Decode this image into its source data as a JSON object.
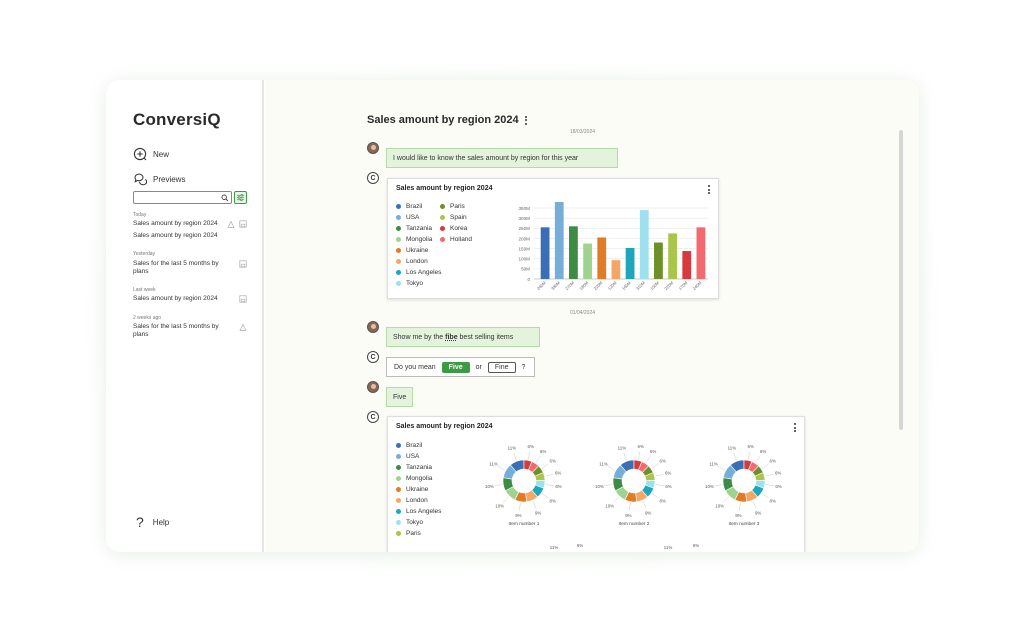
{
  "app": {
    "name": "ConversiQ"
  },
  "sidebar": {
    "new_label": "New",
    "previews_label": "Previews",
    "search_placeholder": "",
    "groups": [
      {
        "label": "Today",
        "items": [
          "Sales amount by region 2024",
          "Sales amount by region 2024"
        ]
      },
      {
        "label": "Yesterday",
        "items": [
          "Sales for the last 5 months by plans"
        ]
      },
      {
        "label": "Last week",
        "items": [
          "Sales amount by region 2024"
        ]
      },
      {
        "label": "2 weeks ago",
        "items": [
          "Sales for the last 5 months by plans"
        ]
      }
    ],
    "help_label": "Help"
  },
  "conversation": {
    "title": "Sales amount by region 2024",
    "date1": "18/03/2024",
    "date2": "01/04/2024",
    "msg1": "I would like to know the sales amount by region for this year",
    "msg2_pre": "Show me by the ",
    "msg2_word": "fibe",
    "msg2_post": " best selling items",
    "q_text": "Do you mean",
    "q_opt_a": "Five",
    "q_or": "or",
    "q_opt_b": "Fine",
    "q_end": "?",
    "msg3": "Five",
    "bot_mark": "C"
  },
  "chart_data": [
    {
      "type": "bar",
      "title": "Sales amount by region 2024",
      "categories": [
        "Brazil",
        "USA",
        "Tanzania",
        "Mongolia",
        "Ukraine",
        "London",
        "Los Angeles",
        "Tokyo",
        "Paris",
        "Spain",
        "Korea",
        "Holland"
      ],
      "values": [
        255,
        380,
        260,
        175,
        205,
        93,
        153,
        340,
        180,
        225,
        138,
        255
      ],
      "value_labels": [
        "240M",
        "380M",
        "270M",
        "180M",
        "220M",
        "120M",
        "160M",
        "310M",
        "150M",
        "220M",
        "170M",
        "240M"
      ],
      "colors": [
        "#3a6fb5",
        "#74aed9",
        "#3d8b45",
        "#9fd48f",
        "#e07c26",
        "#f4a765",
        "#1ea6bd",
        "#9ee0ee",
        "#6f8f2a",
        "#a9c54a",
        "#d63a3e",
        "#f26a6f"
      ],
      "y_ticks": [
        "0",
        "50M",
        "100M",
        "150M",
        "200M",
        "250M",
        "300M",
        "350M"
      ],
      "ylim": [
        0,
        380
      ],
      "grid": true,
      "legend": "left"
    },
    {
      "type": "pie",
      "title": "Sales amount by region 2024",
      "legend": [
        "Brazil",
        "USA",
        "Tanzania",
        "Mongolia",
        "Ukraine",
        "London",
        "Los Angeles",
        "Tokyo",
        "Paris"
      ],
      "donuts": [
        {
          "label": "Item number 1",
          "slices": [
            11,
            6,
            6,
            6,
            6,
            6,
            8,
            9,
            9,
            10,
            10,
            11
          ]
        },
        {
          "label": "Item number 2",
          "slices": [
            11,
            6,
            6,
            6,
            6,
            6,
            8,
            9,
            9,
            10,
            10,
            11
          ]
        },
        {
          "label": "Item number 3",
          "slices": [
            11,
            6,
            6,
            6,
            6,
            6,
            8,
            9,
            9,
            10,
            10,
            11
          ]
        }
      ],
      "slice_labels": [
        "11%",
        "6%",
        "6%",
        "6%",
        "6%",
        "6%",
        "8%",
        "9%",
        "9%",
        "10%",
        "10%",
        "11%"
      ],
      "colors": [
        "#3a6fb5",
        "#d63a3e",
        "#f26a6f",
        "#6f8f2a",
        "#a9c54a",
        "#9ee0ee",
        "#1ea6bd",
        "#f4a765",
        "#e07c26",
        "#9fd48f",
        "#3d8b45",
        "#74aed9"
      ],
      "partial_labels": [
        "11%",
        "6%",
        "11%",
        "6%"
      ]
    }
  ]
}
